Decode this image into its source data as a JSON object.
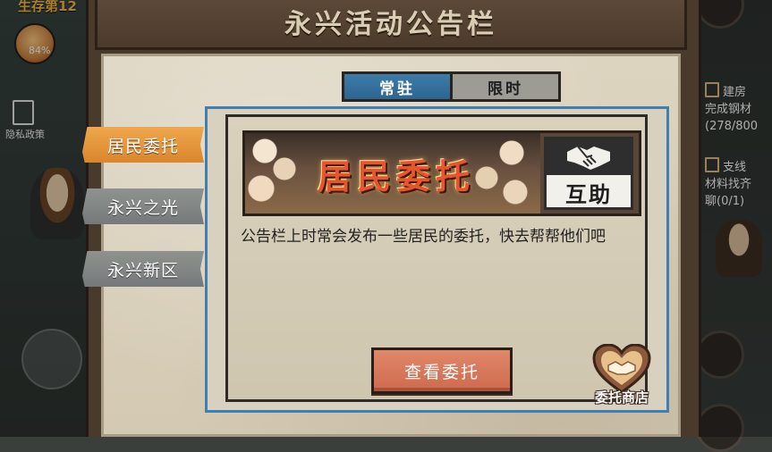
{
  "background": {
    "survive_text": "生存第12",
    "percent": "84%",
    "privacy_label": "隐私政策",
    "quests": [
      {
        "title": "建房",
        "line2": "完成钢材",
        "line3": "(278/800"
      },
      {
        "title": "支线",
        "line2": "材料找齐",
        "line3": "聊(0/1)"
      }
    ]
  },
  "modal": {
    "title": "永兴活动公告栏",
    "tabs": [
      {
        "label": "常驻",
        "active": true
      },
      {
        "label": "限时",
        "active": false
      }
    ],
    "side_menu": [
      {
        "label": "居民委托",
        "active": true
      },
      {
        "label": "永兴之光",
        "active": false
      },
      {
        "label": "永兴新区",
        "active": false
      }
    ],
    "banner": {
      "title": "居民委托",
      "badge_label": "互助",
      "badge_icon": "handshake-icon"
    },
    "description": "公告栏上时常会发布一些居民的委托，快去帮帮他们吧",
    "view_button": "查看委托",
    "shop": {
      "label": "委托商店",
      "icon": "heart-handshake-icon"
    }
  },
  "colors": {
    "tab_active": "#3d7ca8",
    "side_active": "#e8983e",
    "view_button": "#d8775b",
    "panel_border": "#3f7fb2"
  }
}
